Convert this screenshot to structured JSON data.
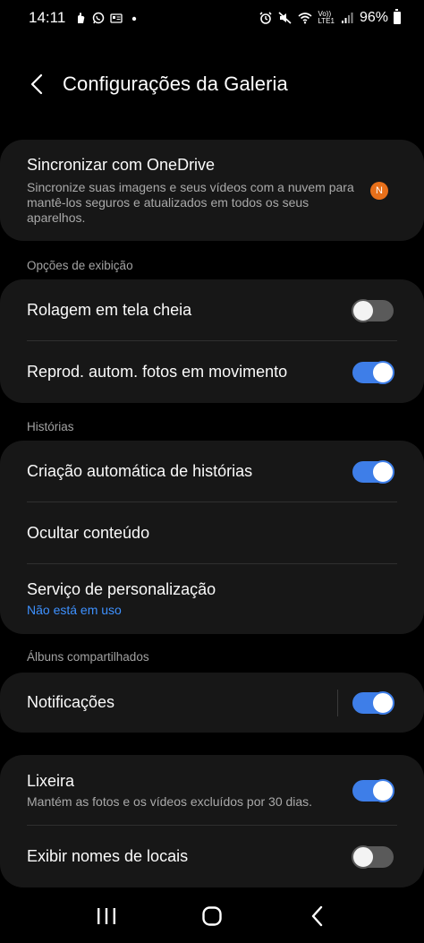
{
  "status_bar": {
    "time": "14:11",
    "left_icons": [
      "notification-hand-icon",
      "whatsapp-icon",
      "id-card-icon",
      "dot-icon"
    ],
    "right_icons": [
      "alarm-icon",
      "mute-icon",
      "wifi-icon",
      "volte-icon",
      "signal-icon"
    ],
    "volte_top": "Vo))",
    "volte_bottom": "LTE1",
    "battery": "96%"
  },
  "header": {
    "title": "Configurações da Galeria"
  },
  "sync_card": {
    "title": "Sincronizar com OneDrive",
    "subtitle": "Sincronize suas imagens e seus vídeos com a nuvem para mantê-los seguros e atualizados em todos os seus aparelhos.",
    "badge": "N",
    "badge_color": "#e8701a"
  },
  "display_section": {
    "label": "Opções de exibição",
    "items": [
      {
        "title": "Rolagem em tela cheia",
        "toggle": "off"
      },
      {
        "title": "Reprod. autom. fotos em movimento",
        "toggle": "on"
      }
    ]
  },
  "stories_section": {
    "label": "Histórias",
    "items": [
      {
        "title": "Criação automática de histórias",
        "toggle": "on"
      },
      {
        "title": "Ocultar conteúdo"
      },
      {
        "title": "Serviço de personalização",
        "subtitle": "Não está em uso"
      }
    ]
  },
  "shared_section": {
    "label": "Álbuns compartilhados",
    "items": [
      {
        "title": "Notificações",
        "toggle": "on"
      }
    ]
  },
  "misc_section": {
    "items": [
      {
        "title": "Lixeira",
        "subtitle": "Mantém as fotos e os vídeos excluídos por 30 dias.",
        "toggle": "on"
      },
      {
        "title": "Exibir nomes de locais",
        "toggle": "off"
      }
    ]
  },
  "colors": {
    "background": "#000000",
    "card": "#171717",
    "accent": "#3e7ee8",
    "link": "#3e91ff"
  },
  "navbar": {
    "buttons": [
      "recents-icon",
      "home-icon",
      "back-icon"
    ]
  }
}
